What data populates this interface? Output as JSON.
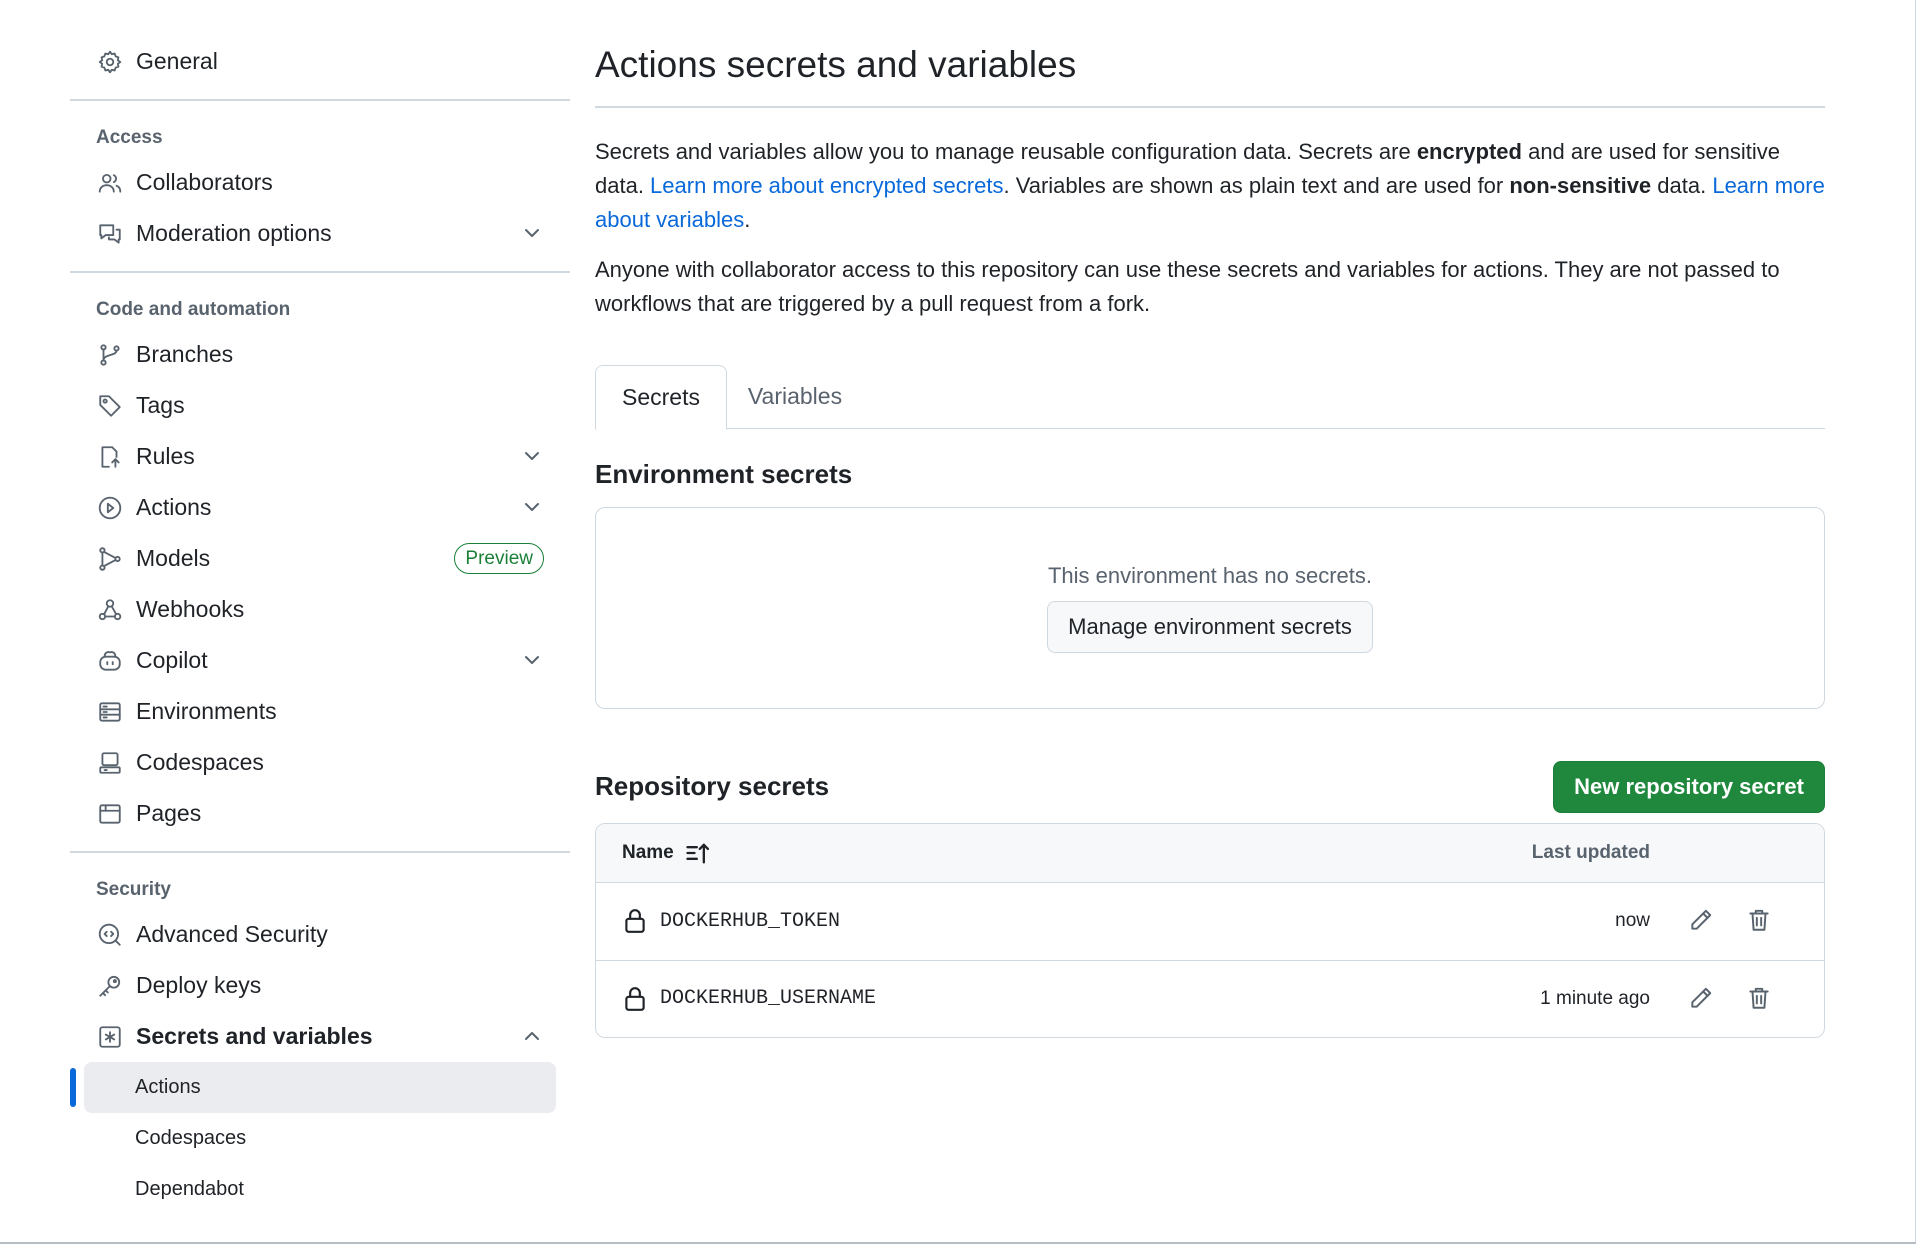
{
  "sidebar": {
    "general": "General",
    "groups": [
      {
        "title": "Access",
        "items": [
          "Collaborators",
          "Moderation options"
        ]
      },
      {
        "title": "Code and automation",
        "items": [
          "Branches",
          "Tags",
          "Rules",
          "Actions",
          "Models",
          "Webhooks",
          "Copilot",
          "Environments",
          "Codespaces",
          "Pages"
        ],
        "models_badge": "Preview"
      },
      {
        "title": "Security",
        "items": [
          "Advanced Security",
          "Deploy keys",
          "Secrets and variables"
        ],
        "sub_items": [
          "Actions",
          "Codespaces",
          "Dependabot"
        ]
      }
    ]
  },
  "main": {
    "title": "Actions secrets and variables",
    "desc1_part1": "Secrets and variables allow you to manage reusable configuration data. Secrets are ",
    "desc1_bold1": "encrypted",
    "desc1_part2": " and are used for sensitive data. ",
    "desc1_link1": "Learn more about encrypted secrets",
    "desc1_part3": ". Variables are shown as plain text and are used for ",
    "desc1_bold2": "non-sensitive",
    "desc1_part4": " data. ",
    "desc1_link2": "Learn more about variables",
    "desc1_part5": ".",
    "desc2": "Anyone with collaborator access to this repository can use these secrets and variables for actions. They are not passed to workflows that are triggered by a pull request from a fork.",
    "tabs": [
      "Secrets",
      "Variables"
    ],
    "env_title": "Environment secrets",
    "env_empty": "This environment has no secrets.",
    "env_button": "Manage environment secrets",
    "repo_title": "Repository secrets",
    "repo_button": "New repository secret",
    "table": {
      "col_name": "Name",
      "col_updated": "Last updated",
      "rows": [
        {
          "name": "DOCKERHUB_TOKEN",
          "updated": "now"
        },
        {
          "name": "DOCKERHUB_USERNAME",
          "updated": "1 minute ago"
        }
      ]
    }
  },
  "colors": {
    "link": "#0969da",
    "primary_button": "#1f883d",
    "badge": "#1a7f37",
    "active_indicator": "#0969da"
  }
}
